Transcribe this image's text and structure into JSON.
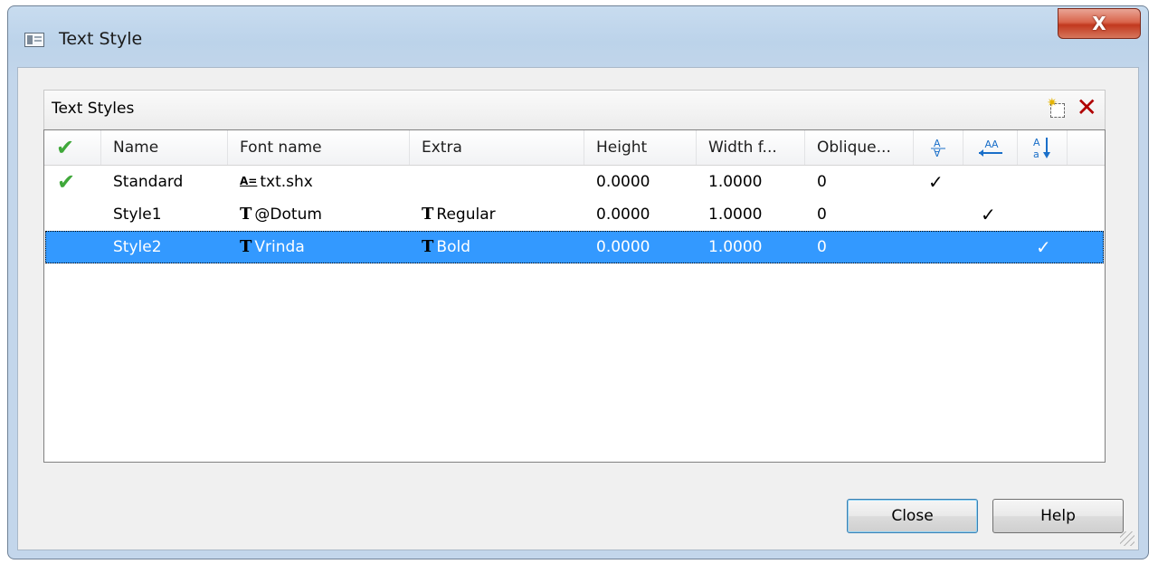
{
  "window": {
    "title": "Text Style",
    "close_glyph": "X"
  },
  "group": {
    "title": "Text Styles"
  },
  "toolbar": {
    "new_icon": "new-style-icon",
    "delete_icon": "delete-icon",
    "delete_glyph": "✕"
  },
  "columns": {
    "current": "✔",
    "name": "Name",
    "font_name": "Font name",
    "extra": "Extra",
    "height": "Height",
    "width": "Width f...",
    "oblique": "Oblique...",
    "upside_down": "upside-down-icon",
    "backwards": "backwards-icon",
    "vertical": "vertical-icon"
  },
  "rows": [
    {
      "current": "✔",
      "name": "Standard",
      "font_icon": "shx-font-icon",
      "font": "txt.shx",
      "extra_icon": "",
      "extra": "",
      "height": "0.0000",
      "width": "1.0000",
      "oblique": "0",
      "upside_down": "✓",
      "backwards": "",
      "vertical": "",
      "selected": false
    },
    {
      "current": "",
      "name": "Style1",
      "font_icon": "truetype-font-icon",
      "font": "@Dotum",
      "extra_icon": "truetype-font-icon",
      "extra": "Regular",
      "height": "0.0000",
      "width": "1.0000",
      "oblique": "0",
      "upside_down": "",
      "backwards": "✓",
      "vertical": "",
      "selected": false
    },
    {
      "current": "",
      "name": "Style2",
      "font_icon": "truetype-font-icon",
      "font": "Vrinda",
      "extra_icon": "truetype-font-icon",
      "extra": "Bold",
      "height": "0.0000",
      "width": "1.0000",
      "oblique": "0",
      "upside_down": "",
      "backwards": "",
      "vertical": "✓",
      "selected": true
    }
  ],
  "buttons": {
    "close": "Close",
    "help": "Help"
  },
  "colors": {
    "selection": "#3399ff",
    "check": "#3fa83a",
    "delete": "#b00000",
    "title_close": "#c2381e"
  }
}
